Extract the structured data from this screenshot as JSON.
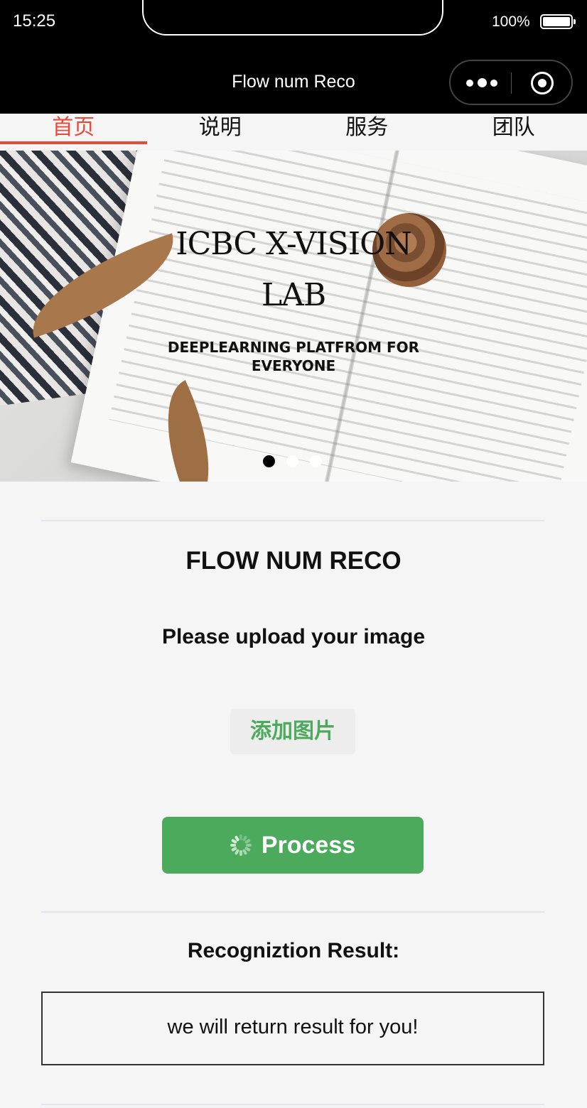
{
  "status_bar": {
    "time": "15:25",
    "battery_percent": "100%"
  },
  "nav": {
    "title": "Flow num Reco",
    "more_icon": "more-dots-icon",
    "close_icon": "target-circle-icon"
  },
  "tabs": [
    {
      "label": "首页",
      "active": true
    },
    {
      "label": "说明",
      "active": false
    },
    {
      "label": "服务",
      "active": false
    },
    {
      "label": "团队",
      "active": false
    }
  ],
  "banner": {
    "title_line1": "ICBC X-VISION",
    "title_line2": "LAB",
    "subtitle_line1": "DEEPLEARNING PLATFROM FOR",
    "subtitle_line2": "EVERYONE",
    "slide_count": 3,
    "active_slide": 1
  },
  "main": {
    "title": "FLOW NUM RECO",
    "upload_prompt": "Please upload your image",
    "add_image_label": "添加图片",
    "process_label": "Process",
    "result_heading": "Recogniztion Result:",
    "result_text": "we will return result for you!"
  },
  "colors": {
    "accent_red": "#e64a3b",
    "primary_green": "#4caa5c",
    "background": "#f5f5f5"
  }
}
